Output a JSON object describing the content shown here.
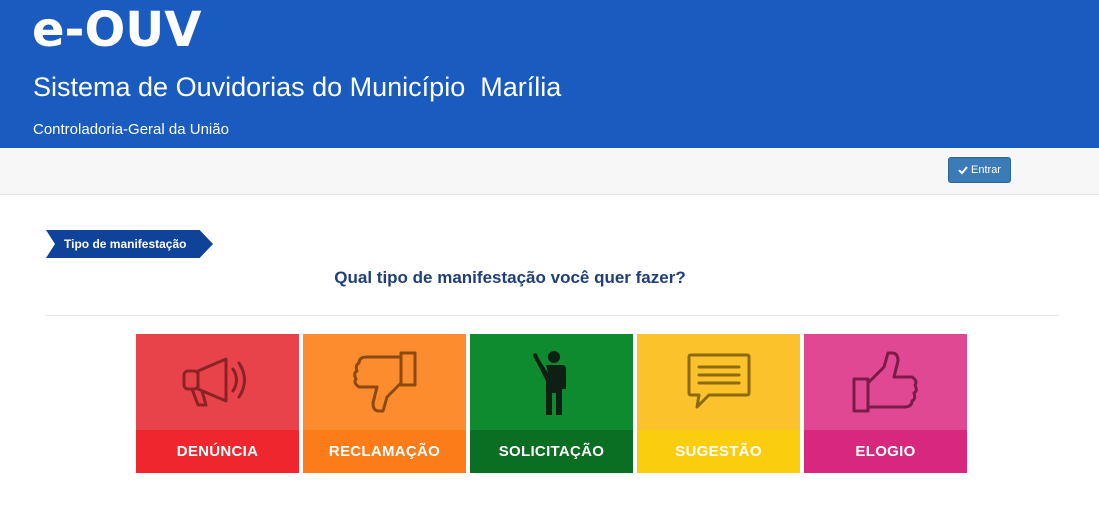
{
  "header": {
    "logo": "e-OUV",
    "subtitle": "Sistema de Ouvidorias do Município  Marília",
    "organization": "Controladoria-Geral da União",
    "background_color": "#1a5bbf"
  },
  "toolbar": {
    "login_label": "Entrar",
    "login_icon": "check-icon"
  },
  "step": {
    "label": "Tipo de manifestação"
  },
  "question": "Qual tipo de manifestação você quer fazer?",
  "tiles": [
    {
      "label": "DENÚNCIA",
      "icon": "megaphone-icon",
      "color": "#f0262e"
    },
    {
      "label": "RECLAMAÇÃO",
      "icon": "thumbs-down-icon",
      "color": "#fc7c1a"
    },
    {
      "label": "SOLICITAÇÃO",
      "icon": "person-raising-hand-icon",
      "color": "#0a6f22"
    },
    {
      "label": "SUGESTÃO",
      "icon": "speech-bubble-icon",
      "color": "#fbcd0f"
    },
    {
      "label": "ELOGIO",
      "icon": "thumbs-up-icon",
      "color": "#d8287d"
    }
  ]
}
